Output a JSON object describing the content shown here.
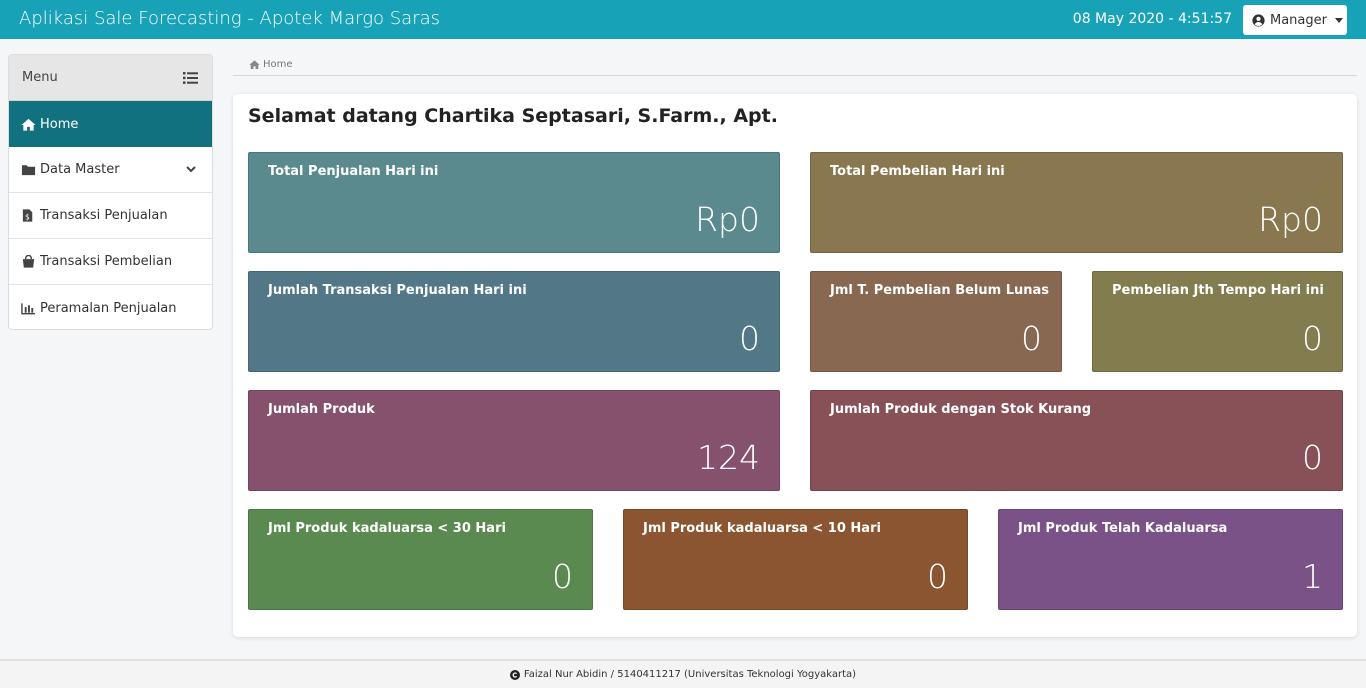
{
  "header": {
    "title": "Aplikasi Sale Forecasting - Apotek Margo Saras",
    "datetime": "08 May 2020 -  4:51:57",
    "user_label": "Manager"
  },
  "sidebar": {
    "menu_label": "Menu",
    "items": [
      {
        "label": "Home",
        "icon": "home-icon",
        "active": true
      },
      {
        "label": "Data Master",
        "icon": "folder-icon"
      },
      {
        "label": "Transaksi Penjualan",
        "icon": "file-invoice-icon"
      },
      {
        "label": "Transaksi Pembelian",
        "icon": "shopping-bag-icon"
      },
      {
        "label": "Peramalan Penjualan",
        "icon": "bar-chart-icon"
      }
    ]
  },
  "breadcrumb": {
    "label": "Home"
  },
  "welcome": "Selamat datang Chartika Septasari, S.Farm., Apt.",
  "cards": {
    "total_penjualan": {
      "label": "Total Penjualan Hari ini",
      "value": "Rp0",
      "color": "#5a8a8e"
    },
    "total_pembelian": {
      "label": "Total Pembelian Hari ini",
      "value": "Rp0",
      "color": "#88774f"
    },
    "jumlah_transaksi": {
      "label": "Jumlah Transaksi Penjualan Hari ini",
      "value": "0",
      "color": "#527887"
    },
    "belum_lunas": {
      "label": "Jml T. Pembelian Belum Lunas",
      "value": "0",
      "color": "#886851"
    },
    "jth_tempo": {
      "label": "Pembelian Jth Tempo Hari ini",
      "value": "0",
      "color": "#837c4f"
    },
    "jumlah_produk": {
      "label": "Jumlah Produk",
      "value": "124",
      "color": "#86516d"
    },
    "stok_kurang": {
      "label": "Jumlah Produk dengan Stok Kurang",
      "value": "0",
      "color": "#885157"
    },
    "kadaluarsa_30": {
      "label": "Jml Produk kadaluarsa < 30 Hari",
      "value": "0",
      "color": "#5b8a51"
    },
    "kadaluarsa_10": {
      "label": "Jml Produk kadaluarsa < 10 Hari",
      "value": "0",
      "color": "#8a5530"
    },
    "telah_kadaluarsa": {
      "label": "Jml Produk Telah Kadaluarsa",
      "value": "1",
      "color": "#7a5288"
    }
  },
  "footer": {
    "text": "Faizal Nur Abidin / 5140411217 (Universitas Teknologi Yogyakarta)"
  }
}
